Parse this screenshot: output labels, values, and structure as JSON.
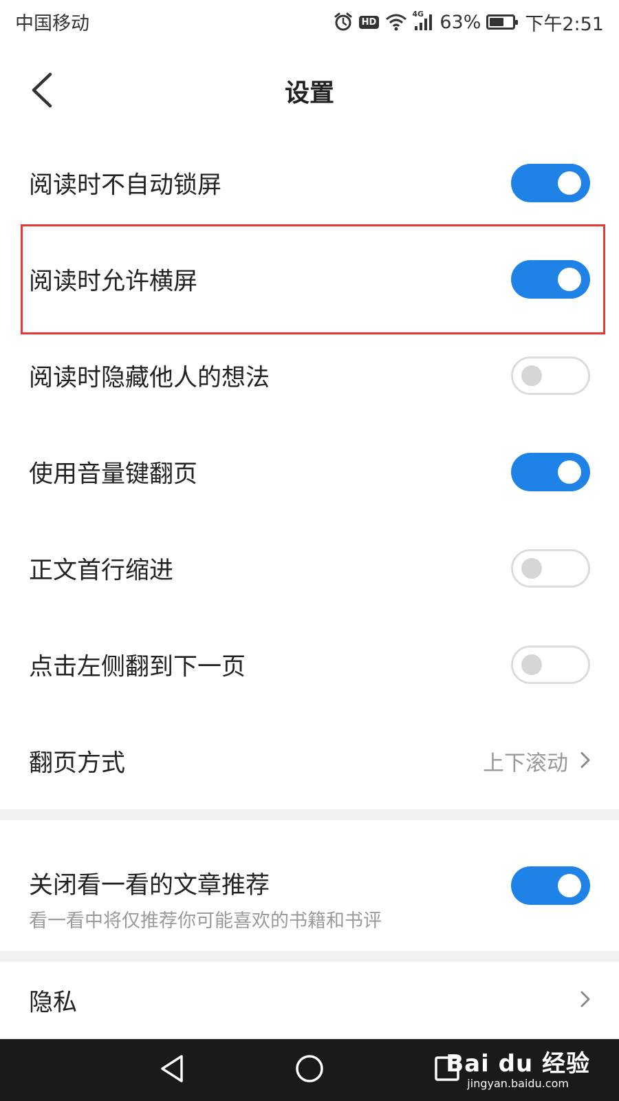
{
  "status_bar": {
    "carrier": "中国移动",
    "network": "4G",
    "battery_percent": "63%",
    "battery_level": 0.63,
    "time": "下午2:51",
    "icons": [
      "alarm-icon",
      "hd-icon",
      "wifi-icon",
      "signal-icon",
      "battery-icon"
    ]
  },
  "header": {
    "title": "设置",
    "back_icon": "chevron-left-icon"
  },
  "settings": [
    {
      "label": "阅读时不自动锁屏",
      "enabled": true
    },
    {
      "label": "阅读时允许横屏",
      "enabled": true,
      "highlighted": true
    },
    {
      "label": "阅读时隐藏他人的想法",
      "enabled": false
    },
    {
      "label": "使用音量键翻页",
      "enabled": true
    },
    {
      "label": "正文首行缩进",
      "enabled": false
    },
    {
      "label": "点击左侧翻到下一页",
      "enabled": false
    }
  ],
  "page_turn": {
    "label": "翻页方式",
    "value": "上下滚动"
  },
  "recommend": {
    "label": "关闭看一看的文章推荐",
    "sublabel": "看一看中将仅推荐你可能喜欢的书籍和书评",
    "enabled": true
  },
  "privacy": {
    "label": "隐私"
  },
  "nav_bar": {
    "buttons": [
      "back-triangle-icon",
      "home-circle-icon",
      "recents-square-icon"
    ]
  },
  "watermark": {
    "logo": "Bai du 经验",
    "url": "jingyan.baidu.com"
  },
  "colors": {
    "toggle_on": "#1e82e6",
    "toggle_off_border": "#dcdcdc",
    "highlight": "#e53935",
    "nav_bar": "#1a1a1a"
  }
}
